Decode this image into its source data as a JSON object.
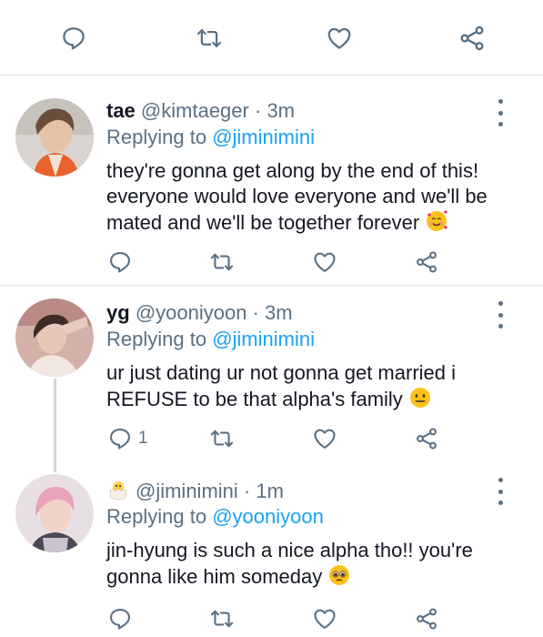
{
  "top_actions": {
    "reply": "",
    "retweet": "",
    "like": "",
    "share": ""
  },
  "tweets": [
    {
      "name": "tae",
      "handle": "@kimtaeger",
      "separator": "·",
      "time": "3m",
      "replying_prefix": "Replying to",
      "replying_to": "@jiminimini",
      "text": "they're gonna get along by the end of this! everyone would love everyone and we'll be mated and we'll be together forever",
      "emoji": "smiling-face-with-hearts-icon",
      "reply_count": ""
    },
    {
      "name": "yg",
      "handle": "@yooniyoon",
      "separator": "·",
      "time": "3m",
      "replying_prefix": "Replying to",
      "replying_to": "@jiminimini",
      "text": "ur just dating ur not gonna get married i REFUSE to be that alpha's family",
      "emoji": "neutral-face-icon",
      "reply_count": "1"
    },
    {
      "name": "",
      "handle": "@jiminimini",
      "separator": "·",
      "time": "1m",
      "replying_prefix": "Replying to",
      "replying_to": "@yooniyoon",
      "text": "jin-hyung is such a nice alpha tho!! you're gonna like him someday",
      "emoji": "pleading-face-icon",
      "name_emoji": "hatching-chick-icon",
      "reply_count": ""
    }
  ],
  "colors": {
    "mention": "#1da1f2",
    "icon": "#5b7083",
    "divider": "#e3e7ea",
    "thread_line": "#cfd9de"
  }
}
